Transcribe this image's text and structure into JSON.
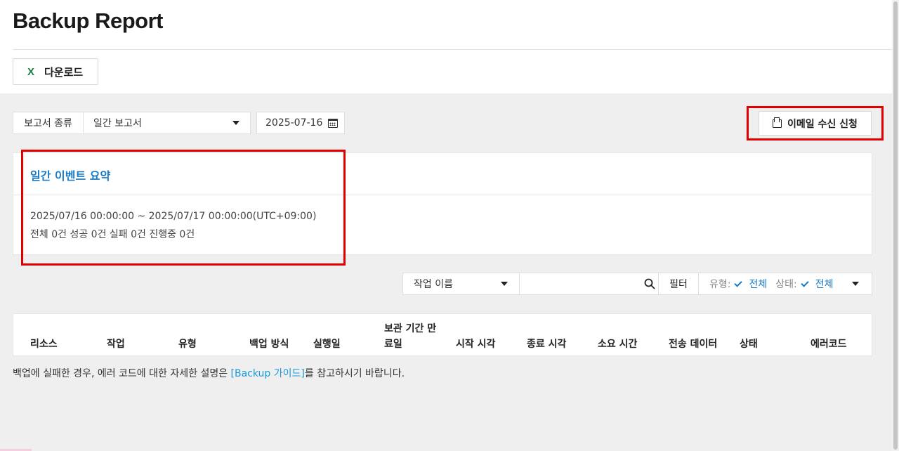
{
  "header": {
    "title": "Backup Report",
    "download_label": "다운로드"
  },
  "toolbar": {
    "report_type_label": "보고서 종류",
    "report_type_value": "일간 보고서",
    "date_value": "2025-07-16",
    "email_button_label": "이메일 수신 신청"
  },
  "summary": {
    "title": "일간 이벤트 요약",
    "range": "2025/07/16 00:00:00 ~ 2025/07/17 00:00:00(UTC+09:00)",
    "counts": "전체 0건 성공 0건 실패 0건 진행중 0건"
  },
  "filters": {
    "job_select_value": "작업 이름",
    "search_value": "",
    "filter_button_label": "필터",
    "type_label": "유형:",
    "type_value": "전체",
    "status_label": "상태:",
    "status_value": "전체"
  },
  "table": {
    "columns": [
      "리소스",
      "작업",
      "유형",
      "백업 방식",
      "실행일",
      "보관 기간 만",
      "료일",
      "시작 시각",
      "종료 시각",
      "소요 시간",
      "전송 데이터",
      "상태",
      "에러코드"
    ]
  },
  "note": {
    "prefix": "백업에 실패한 경우, 에러 코드에 대한 자세한 설명은 ",
    "link": "[Backup 가이드]",
    "suffix": "를 참고하시기 바랍니다."
  },
  "colors": {
    "accent": "#1a7ac6",
    "link": "#1a98d8",
    "highlight": "#e10000",
    "excel": "#1e7d45"
  },
  "icons": [
    "excel-icon",
    "calendar-icon",
    "mail-icon",
    "search-icon",
    "check-icon",
    "chevron-down-icon"
  ]
}
